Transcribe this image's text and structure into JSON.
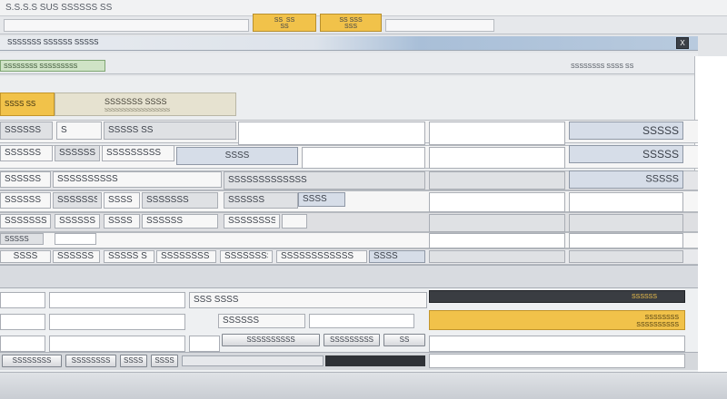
{
  "topbar": {
    "title": "S.S.S.S SUS SSSSSS SS",
    "tab1": "SS  SS\nSS",
    "tab2": "SS SSS\nSSS"
  },
  "window": {
    "title": "SSSSSSS SSSSSS SSSSS",
    "close_glyph": "X",
    "green_label": "SSSSSSSS SSSSSSSSS",
    "right_label": "SSSSSSSS SSSS SS"
  },
  "header": {
    "badge": "SSSS SS",
    "title": "SSSSSSS SSSS",
    "subtitle": "SSSSSSSSSSSSSSSSSS"
  },
  "grid": {
    "r1": {
      "c1": "SSSSSS",
      "c2": "S",
      "c3": "SSSSS SS"
    },
    "r2": {
      "c1": "SSSSSS",
      "c2": "SSSSSSSS",
      "c3": "SSSSSSSSS",
      "c4": "SSSS"
    },
    "r3": {
      "c1": "SSSSSS",
      "c2": "SSSSSSSSSS",
      "c3": "SSSSSSSSSSSSS"
    },
    "r4": {
      "c1": "SSSSSS",
      "c2": "SSSSSSS",
      "c3": "SSSS",
      "c4": "SSSSSSS",
      "c5": "SSSSSS",
      "c6": "SSSS"
    },
    "r5": {
      "c1": "SSSSSSS",
      "c2": "SSSSSS",
      "c3": "SSSS",
      "c4": "SSSSSS",
      "c5": "SSSSSSSS"
    },
    "r6": {
      "c1": "SSSSS"
    },
    "r7": {
      "c1": "SSSS",
      "c2": "SSSSSS",
      "c3": "SSSSS S",
      "c4": "SSSSSSSS",
      "c5": "SSSSSSSS",
      "c6": "SSSSSSSSSSSS",
      "c7": "SSSS"
    }
  },
  "right_panel": {
    "v1": "SSSSS",
    "v2": "SSSSS",
    "v3": "SSSSS"
  },
  "lower": {
    "l1": "SSS  SSSS",
    "l2": "SSSSSS",
    "yellow_dark_label": "SSSSSS",
    "yellow_label": "SSSSSSSS\nSSSSSSSSSS",
    "buttons": [
      "SSSSSSSSSS",
      "SSSSSSSSS",
      "SS"
    ],
    "bottom": [
      "SSSSSSSS",
      "SSSSSSSS",
      "SSSSS",
      "SSSS"
    ]
  }
}
